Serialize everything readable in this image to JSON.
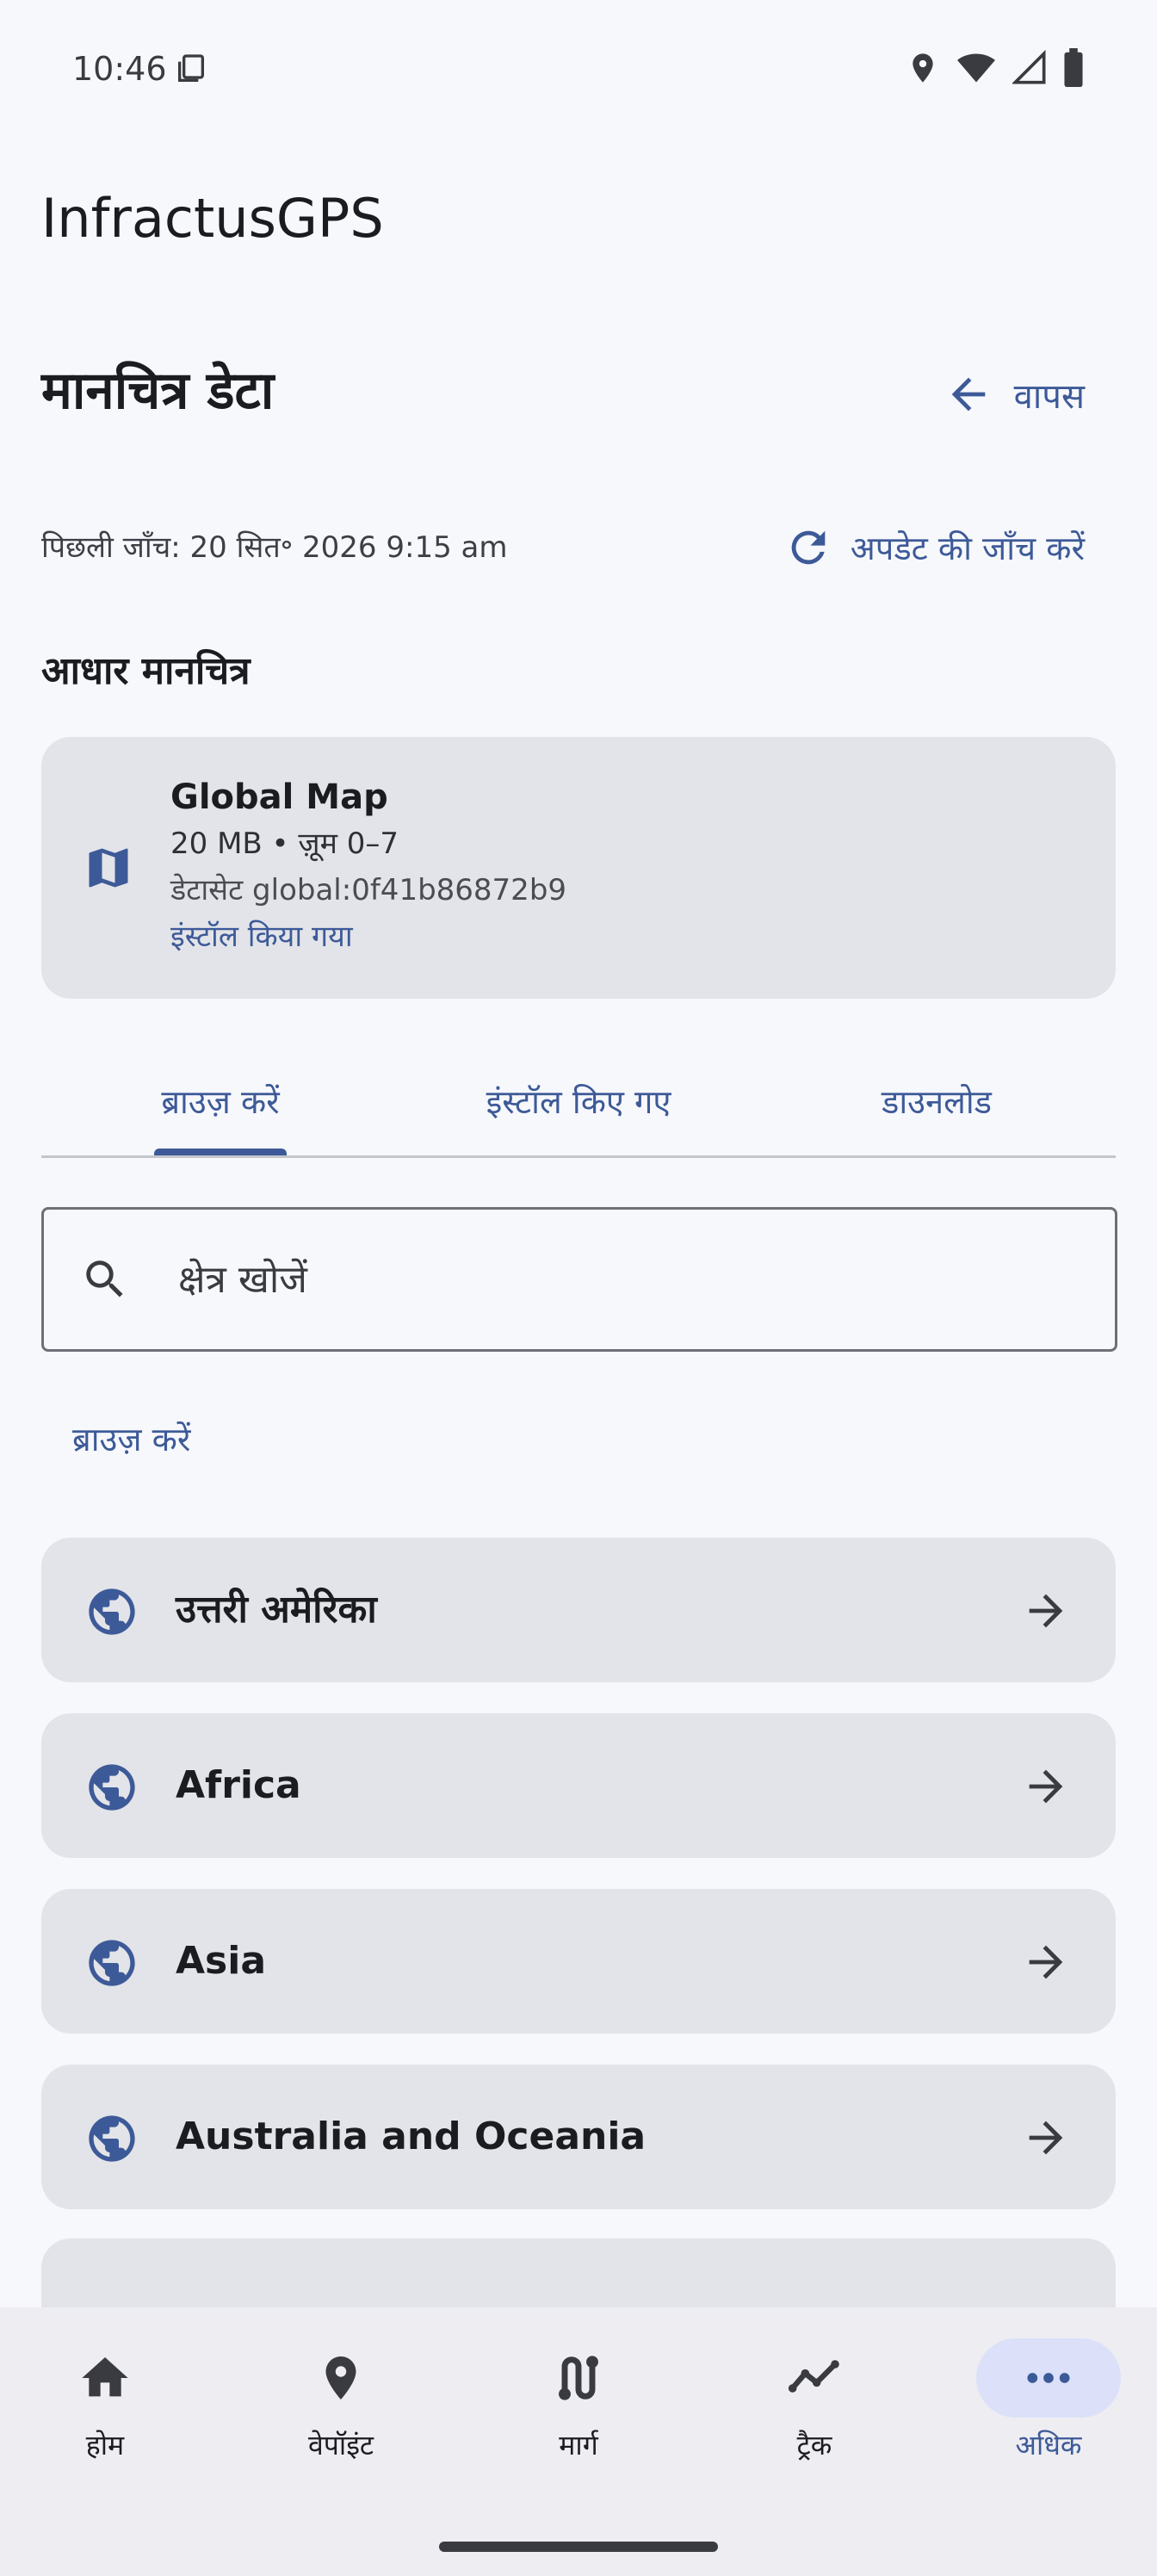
{
  "status_bar": {
    "time": "10:46"
  },
  "app": {
    "title": "InfractusGPS"
  },
  "header": {
    "title": "मानचित्र डेटा",
    "back_label": "वापस"
  },
  "update": {
    "last_check": "पिछली जाँच: 20 सित॰ 2026 9:15 am",
    "check_label": "अपडेट की जाँच करें"
  },
  "base_map": {
    "section_title": "आधार मानचित्र",
    "name": "Global Map",
    "meta": "20 MB • ज़ूम 0–7",
    "dataset": "डेटासेट global:0f41b86872b9",
    "status": "इंस्टॉल किया गया"
  },
  "tabs": [
    {
      "label": "ब्राउज़ करें",
      "active": true
    },
    {
      "label": "इंस्टॉल किए गए",
      "active": false
    },
    {
      "label": "डाउनलोड",
      "active": false
    }
  ],
  "search": {
    "placeholder": "क्षेत्र खोजें"
  },
  "browse": {
    "label": "ब्राउज़ करें",
    "regions": [
      {
        "label": "उत्तरी अमेरिका"
      },
      {
        "label": "Africa"
      },
      {
        "label": "Asia"
      },
      {
        "label": "Australia and Oceania"
      }
    ]
  },
  "bottom_nav": [
    {
      "label": "होम",
      "icon": "home-icon"
    },
    {
      "label": "वेपॉइंट",
      "icon": "location-pin-icon"
    },
    {
      "label": "मार्ग",
      "icon": "route-icon"
    },
    {
      "label": "ट्रैक",
      "icon": "track-icon"
    },
    {
      "label": "अधिक",
      "icon": "more-icon",
      "active": true
    }
  ],
  "colors": {
    "accent": "#3d5a98",
    "card": "#e3e4e9",
    "background": "#f7f8fc",
    "nav_active": "#dce1f9"
  }
}
